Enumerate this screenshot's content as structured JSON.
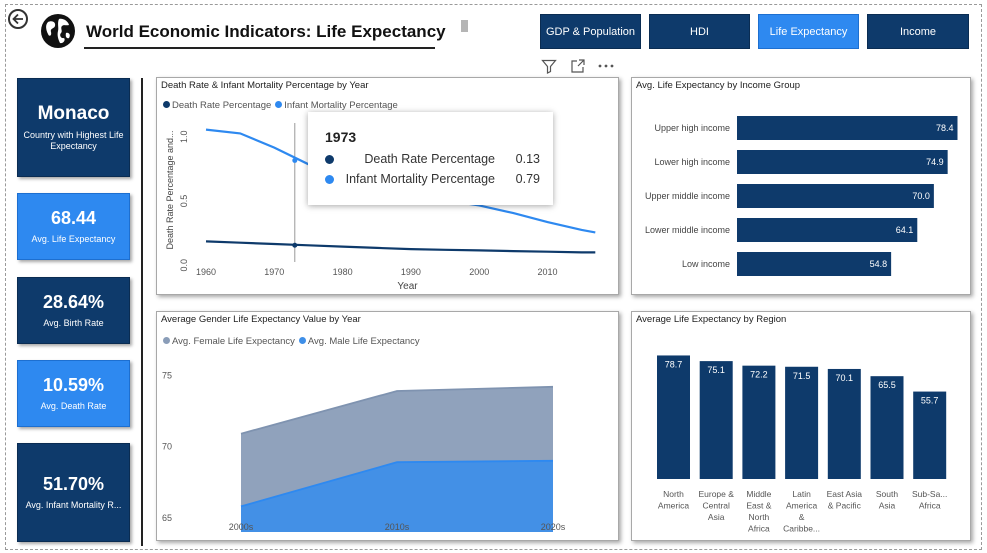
{
  "header": {
    "title": "World Economic Indicators: Life Expectancy"
  },
  "nav": [
    {
      "label": "GDP & Population",
      "active": false
    },
    {
      "label": "HDI",
      "active": false
    },
    {
      "label": "Life Expectancy",
      "active": true
    },
    {
      "label": "Income",
      "active": false
    }
  ],
  "kpis": [
    {
      "value": "Monaco",
      "label": "Country with Highest Life Expectancy",
      "style": "dark"
    },
    {
      "value": "68.44",
      "label": "Avg. Life Expectancy",
      "style": "light"
    },
    {
      "value": "28.64%",
      "label": "Avg. Birth Rate",
      "style": "dark"
    },
    {
      "value": "10.59%",
      "label": "Avg. Death Rate",
      "style": "light"
    },
    {
      "value": "51.70%",
      "label": "Avg. Infant Mortality R...",
      "style": "dark"
    }
  ],
  "colors": {
    "dark_navy": "#0e3a6b",
    "bright_blue": "#2e89f0",
    "female_gray": "#8a9db8",
    "male_blue": "#3f8fe8"
  },
  "panels": {
    "death_rate": {
      "title": "Death Rate & Infant Mortality Percentage by Year",
      "legend": [
        "Death Rate Percentage",
        "Infant Mortality Percentage"
      ],
      "xlabel": "Year",
      "ylabel": "Death Rate Percentage and..."
    },
    "income": {
      "title": "Avg. Life Expectancy by Income Group"
    },
    "gender": {
      "title": "Average Gender Life Expectancy Value by Year",
      "legend": [
        "Avg. Female Life Expectancy",
        "Avg. Male Life Expectancy"
      ]
    },
    "region": {
      "title": "Average Life Expectancy by Region"
    }
  },
  "tooltip": {
    "year": "1973",
    "rows": [
      {
        "name": "Death Rate Percentage",
        "value": "0.13"
      },
      {
        "name": "Infant Mortality Percentage",
        "value": "0.79"
      }
    ]
  },
  "chart_data": [
    {
      "type": "line",
      "title": "Death Rate & Infant Mortality Percentage by Year",
      "xlabel": "Year",
      "ylabel": "Death Rate Percentage and...",
      "x": [
        1960,
        1965,
        1970,
        1975,
        1980,
        1985,
        1990,
        1995,
        2000,
        2005,
        2010,
        2015,
        2017
      ],
      "xticks": [
        1960,
        1970,
        1980,
        1990,
        2000,
        2010
      ],
      "yticks": [
        "0.0",
        "0.5",
        "1.0"
      ],
      "ylim": [
        0,
        1.12
      ],
      "series": [
        {
          "name": "Death Rate Percentage",
          "values": [
            0.16,
            0.15,
            0.14,
            0.13,
            0.12,
            0.11,
            0.1,
            0.095,
            0.09,
            0.085,
            0.08,
            0.075,
            0.075
          ]
        },
        {
          "name": "Infant Mortality Percentage",
          "values": [
            1.03,
            1.0,
            0.89,
            0.76,
            0.68,
            0.58,
            0.53,
            0.48,
            0.44,
            0.38,
            0.31,
            0.25,
            0.23
          ]
        }
      ],
      "hover_x": 1973,
      "legend": "top-left",
      "grid": false
    },
    {
      "type": "bar",
      "orientation": "horizontal",
      "title": "Avg. Life Expectancy by Income Group",
      "categories": [
        "Upper high income",
        "Lower high income",
        "Upper middle income",
        "Lower middle income",
        "Low income"
      ],
      "values": [
        78.4,
        74.9,
        70.0,
        64.1,
        54.8
      ],
      "data_labels": [
        "78.4",
        "74.9",
        "70.0",
        "64.1",
        "54.8"
      ],
      "xlim": [
        0,
        80
      ]
    },
    {
      "type": "area",
      "title": "Average Gender Life Expectancy Value by Year",
      "categories": [
        "2000s",
        "2010s",
        "2020s"
      ],
      "yticks": [
        65,
        70,
        75
      ],
      "ylim": [
        64,
        76.5
      ],
      "series": [
        {
          "name": "Avg. Female Life Expectancy",
          "values": [
            70.9,
            73.9,
            74.2
          ]
        },
        {
          "name": "Avg. Male Life Expectancy",
          "values": [
            65.8,
            68.9,
            69.0
          ]
        }
      ],
      "legend": "top-left"
    },
    {
      "type": "bar",
      "title": "Average Life Expectancy by Region",
      "categories": [
        "North America",
        "Europe & Central Asia",
        "Middle East & North Africa",
        "Latin America & Caribbe...",
        "East Asia & Pacific",
        "South Asia",
        "Sub-Sa... Africa"
      ],
      "category_lines": [
        [
          "North",
          "America"
        ],
        [
          "Europe &",
          "Central",
          "Asia"
        ],
        [
          "Middle",
          "East &",
          "North",
          "Africa"
        ],
        [
          "Latin",
          "America",
          "&",
          "Caribbe..."
        ],
        [
          "East Asia",
          "& Pacific"
        ],
        [
          "South",
          "Asia"
        ],
        [
          "Sub-Sa...",
          "Africa"
        ]
      ],
      "values": [
        78.7,
        75.1,
        72.2,
        71.5,
        70.1,
        65.5,
        55.7
      ],
      "data_labels": [
        "78.7",
        "75.1",
        "72.2",
        "71.5",
        "70.1",
        "65.5",
        "55.7"
      ],
      "ylim": [
        0,
        86
      ]
    }
  ]
}
